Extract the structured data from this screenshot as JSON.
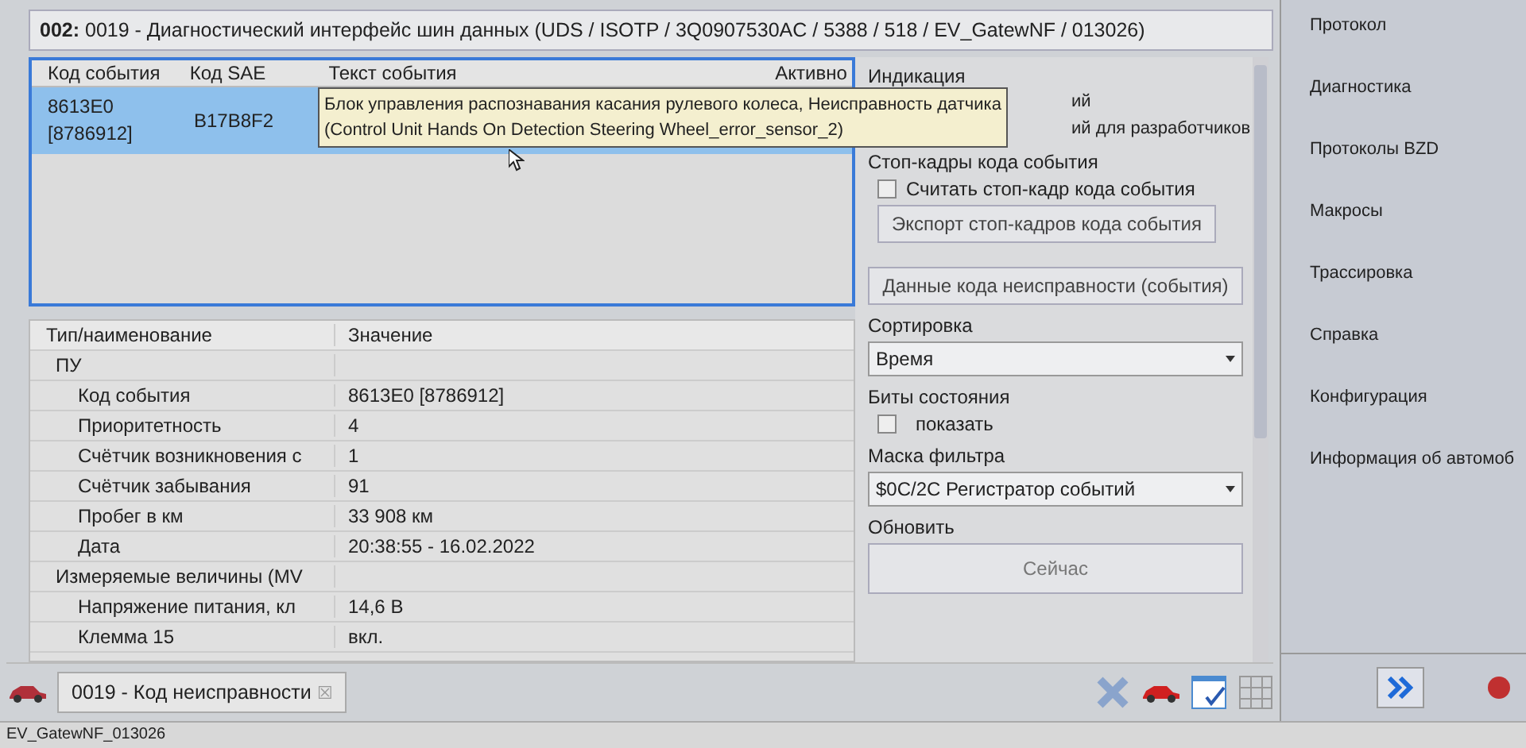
{
  "title": {
    "prefix": "002:",
    "text": "0019 - Диагностический интерфейс шин данных  (UDS / ISOTP / 3Q0907530AC / 5388 / 518 / EV_GatewNF / 013026)"
  },
  "events": {
    "columns": [
      "Код события",
      "Код SAE",
      "Текст события",
      "Активно"
    ],
    "rows": [
      {
        "code": "8613E0\n[8786912]",
        "sae": "B17B8F2",
        "selected": true
      }
    ],
    "tooltip": [
      "Блок управления распознавания касания рулевого колеса, Неисправность датчика",
      "(Control Unit Hands On Detection Steering Wheel_error_sensor_2)"
    ]
  },
  "details": {
    "columns": [
      "Тип/наименование",
      "Значение"
    ],
    "groups": [
      {
        "name": "ПУ",
        "children": [
          {
            "name": "Код события",
            "value": "8613E0 [8786912]"
          },
          {
            "name": "Приоритетность",
            "value": "4"
          },
          {
            "name": "Счётчик возникновения с",
            "value": "1"
          },
          {
            "name": "Счётчик забывания",
            "value": "91"
          },
          {
            "name": "Пробег в км",
            "value": "33 908 км"
          },
          {
            "name": "Дата",
            "value": "20:38:55 - 16.02.2022"
          }
        ]
      },
      {
        "name": "Измеряемые величины (MV",
        "children": [
          {
            "name": "Напряжение питания, кл",
            "value": "14,6 В"
          },
          {
            "name": "Клемма 15",
            "value": "вкл."
          }
        ]
      }
    ]
  },
  "options": {
    "indication": {
      "label": "Индикация",
      "items": [
        "ий",
        "ий для разработчиков"
      ]
    },
    "freeze": {
      "label": "Стоп-кадры кода события",
      "checkbox": {
        "label": "Считать стоп-кадр кода события",
        "checked": false
      },
      "button": "Экспорт стоп-кадров кода события"
    },
    "fault_button": "Данные кода неисправности (события)",
    "sort": {
      "label": "Сортировка",
      "value": "Время"
    },
    "status_bits": {
      "label": "Биты состояния",
      "checkbox": {
        "label": "показать",
        "checked": false
      }
    },
    "filter": {
      "label": "Маска фильтра",
      "value": "$0C/2C Регистратор событий"
    },
    "refresh": {
      "label": "Обновить",
      "button": "Сейчас"
    }
  },
  "tab": {
    "label": "0019 - Код неисправности",
    "close": "☒"
  },
  "sidebar": {
    "items": [
      "Протокол",
      "Диагностика",
      "Протоколы BZD",
      "Макросы",
      "Трассировка",
      "Справка",
      "Конфигурация",
      "Информация об автомоб"
    ]
  },
  "status_bar": "EV_GatewNF_013026"
}
